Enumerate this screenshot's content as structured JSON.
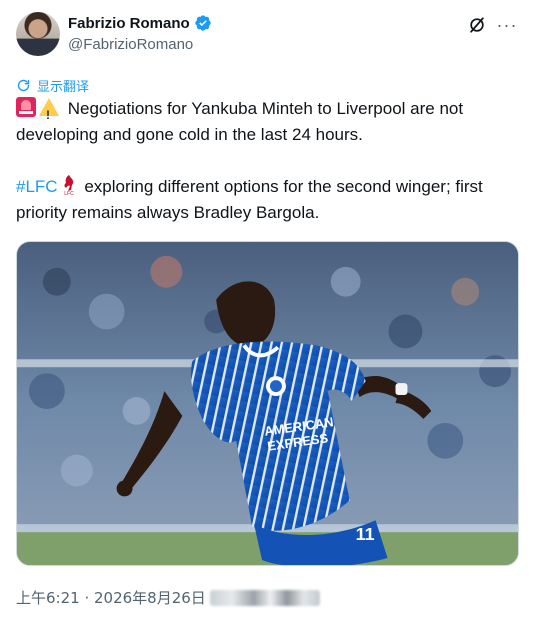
{
  "author": {
    "display_name": "Fabrizio Romano",
    "handle": "@FabrizioRomano",
    "verified": true
  },
  "actions": {
    "grok_icon": "grok-icon",
    "more_icon": "more-icon",
    "more_label": "···"
  },
  "translate_label": "显示翻译",
  "tweet": {
    "line1": "Negotiations for Yankuba Minteh to Liverpool are not developing and gone cold in the last 24 hours.",
    "hashtag": "#LFC",
    "line2": "exploring different options for the second winger; first priority remains always Bradley Bargola."
  },
  "media": {
    "alt": "Player in blue and white striped kit",
    "shirt_sponsor": "AMERICAN EXPRESS",
    "shirt_number": "11"
  },
  "meta": {
    "timestamp": "上午6:21 · 2026年8月26日"
  },
  "colors": {
    "accent": "#1d9bf0",
    "text": "#0f1419",
    "secondary": "#536471"
  }
}
